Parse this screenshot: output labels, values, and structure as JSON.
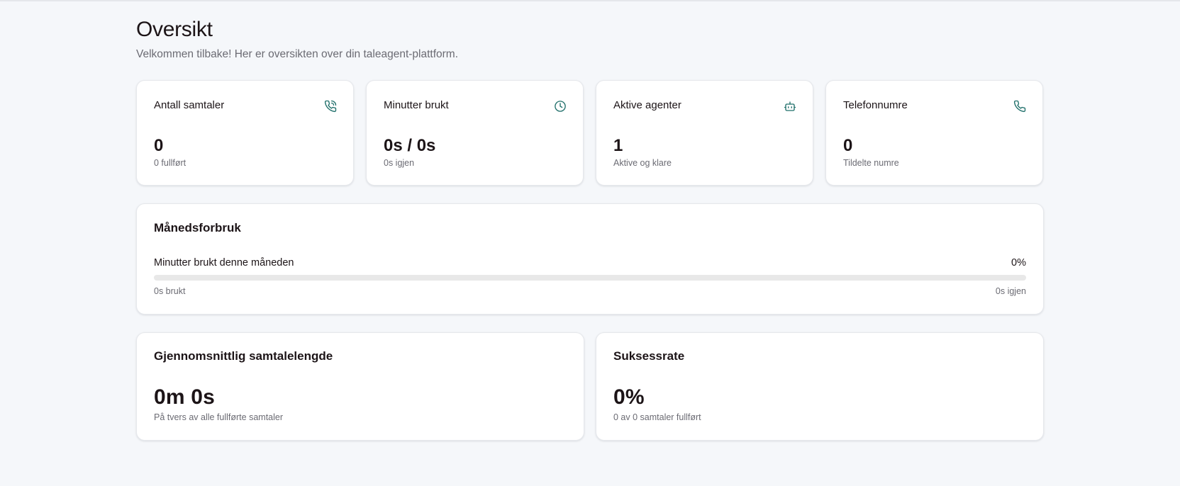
{
  "header": {
    "title": "Oversikt",
    "subtitle": "Velkommen tilbake! Her er oversikten over din taleagent-plattform."
  },
  "stats": [
    {
      "label": "Antall samtaler",
      "value": "0",
      "sub": "0 fullført",
      "icon": "phone-call-icon"
    },
    {
      "label": "Minutter brukt",
      "value": "0s / 0s",
      "sub": "0s igjen",
      "icon": "clock-icon"
    },
    {
      "label": "Aktive agenter",
      "value": "1",
      "sub": "Aktive og klare",
      "icon": "bot-icon"
    },
    {
      "label": "Telefonnumre",
      "value": "0",
      "sub": "Tildelte numre",
      "icon": "phone-icon"
    }
  ],
  "usage": {
    "title": "Månedsforbruk",
    "label": "Minutter brukt denne måneden",
    "percent_label": "0%",
    "progress": 0,
    "used": "0s brukt",
    "remaining": "0s igjen"
  },
  "avg_duration": {
    "title": "Gjennomsnittlig samtalelengde",
    "value": "0m 0s",
    "sub": "På tvers av alle fullførte samtaler"
  },
  "success_rate": {
    "title": "Suksessrate",
    "value": "0%",
    "sub": "0 av 0 samtaler fullført"
  },
  "colors": {
    "accent": "#1f6f6a",
    "background": "#f5f7fa",
    "card": "#ffffff",
    "muted_text": "#6b6b73",
    "progress_track": "#e8e8e8"
  }
}
